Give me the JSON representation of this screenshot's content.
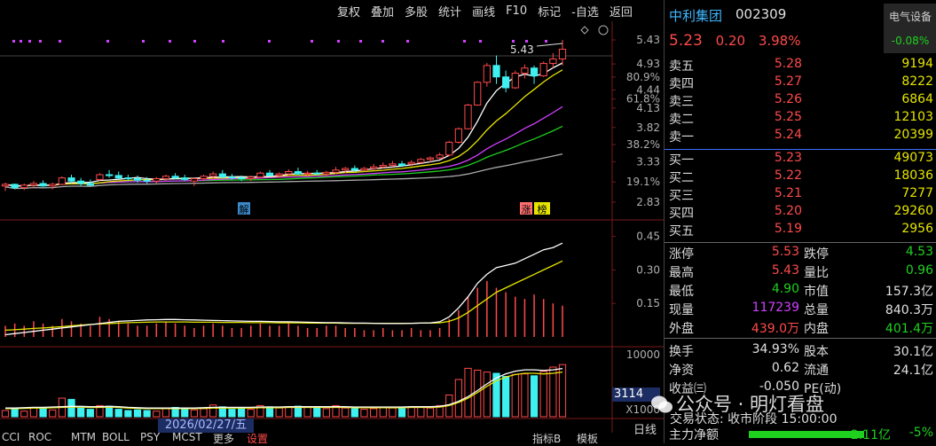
{
  "toolbar": [
    "复权",
    "叠加",
    "多股",
    "统计",
    "画线",
    "F10",
    "标记",
    "-自选",
    "返回"
  ],
  "stock": {
    "name": "中利集团",
    "code": "002309",
    "price": "5.23",
    "change": "0.20",
    "pct": "3.98%"
  },
  "sector": {
    "name": "电气设备",
    "change": "-0.08%"
  },
  "orderbook": {
    "asks": [
      {
        "l": "卖五",
        "p": "5.28",
        "v": "9194"
      },
      {
        "l": "卖四",
        "p": "5.27",
        "v": "8222"
      },
      {
        "l": "卖三",
        "p": "5.26",
        "v": "6864"
      },
      {
        "l": "卖二",
        "p": "5.25",
        "v": "12103"
      },
      {
        "l": "卖一",
        "p": "5.24",
        "v": "20399"
      }
    ],
    "bids": [
      {
        "l": "买一",
        "p": "5.23",
        "v": "49073"
      },
      {
        "l": "买二",
        "p": "5.22",
        "v": "18036"
      },
      {
        "l": "买三",
        "p": "5.21",
        "v": "7277"
      },
      {
        "l": "买四",
        "p": "5.20",
        "v": "29260"
      },
      {
        "l": "买五",
        "p": "5.19",
        "v": "2956"
      }
    ]
  },
  "stats": [
    {
      "l1": "涨停",
      "v1": "5.53",
      "c1": "r",
      "l2": "跌停",
      "v2": "4.53",
      "c2": "g"
    },
    {
      "l1": "最高",
      "v1": "5.43",
      "c1": "r",
      "l2": "量比",
      "v2": "0.96",
      "c2": "g"
    },
    {
      "l1": "最低",
      "v1": "4.90",
      "c1": "g",
      "l2": "市值",
      "v2": "157.3亿",
      "c2": "w"
    },
    {
      "l1": "现量",
      "v1": "117239",
      "c1": "m",
      "l2": "总量",
      "v2": "840.3万",
      "c2": "w"
    },
    {
      "l1": "外盘",
      "v1": "439.0万",
      "c1": "r",
      "l2": "内盘",
      "v2": "401.4万",
      "c2": "g"
    },
    {
      "l1": "换手",
      "v1": "34.93%",
      "c1": "w",
      "l2": "股本",
      "v2": "30.1亿",
      "c2": "w"
    },
    {
      "l1": "净资",
      "v1": "0.62",
      "c1": "w",
      "l2": "流通",
      "v2": "24.1亿",
      "c2": "w"
    },
    {
      "l1": "收益㈢",
      "v1": "-0.050",
      "c1": "w",
      "l2": "PE(动)",
      "v2": "",
      "c2": "w"
    }
  ],
  "trade_status": "交易状态: 收市阶段 15:00:00",
  "net_flow": {
    "label": "主力净额",
    "value": "-2.11亿",
    "pct": "-5%"
  },
  "watermark": "公众号 · 明灯看盘",
  "axis_main": [
    "5.43",
    "4.93",
    "80.9%",
    "4.44",
    "61.8%",
    "4.13",
    "3.82",
    "38.2%",
    "3.33",
    "19.1%",
    "2.83"
  ],
  "axis_ind": [
    "0.45",
    "0.30",
    "0.15"
  ],
  "axis_vol": [
    "10000",
    "X1000"
  ],
  "vol_tag": "3114",
  "date_tag": "2026/02/27/五",
  "high_label": "5.43",
  "bottom_tabs": [
    "CCI",
    "ROC",
    "MTM",
    "BOLL",
    "PSY",
    "MCST",
    "更多",
    "设置"
  ],
  "bottom_right": [
    "指标B",
    "模板"
  ],
  "xian": "日线",
  "tag_jie": "解",
  "tag_zt": "涨",
  "tag_bang": "榜",
  "colors": {
    "up": "#ff4a4a",
    "down": "#3ef0f0",
    "ma5": "#ffffff",
    "ma10": "#e5e500",
    "ma20": "#d040ff",
    "ma30": "#1fd11f",
    "ma60": "#aaaaaa"
  },
  "candles": [
    [
      3.02,
      3.06,
      2.96,
      3.04
    ],
    [
      3.04,
      3.05,
      2.98,
      3.0
    ],
    [
      3.0,
      3.05,
      2.97,
      3.03
    ],
    [
      3.03,
      3.08,
      3.0,
      3.05
    ],
    [
      3.05,
      3.09,
      3.01,
      3.02
    ],
    [
      3.02,
      3.06,
      2.98,
      3.04
    ],
    [
      3.04,
      3.14,
      3.03,
      3.12
    ],
    [
      3.12,
      3.16,
      3.05,
      3.08
    ],
    [
      3.08,
      3.12,
      3.02,
      3.05
    ],
    [
      3.05,
      3.1,
      3.02,
      3.03
    ],
    [
      3.1,
      3.18,
      3.08,
      3.16
    ],
    [
      3.16,
      3.22,
      3.12,
      3.15
    ],
    [
      3.15,
      3.2,
      3.1,
      3.12
    ],
    [
      3.12,
      3.16,
      3.08,
      3.11
    ],
    [
      3.11,
      3.15,
      3.06,
      3.09
    ],
    [
      3.09,
      3.13,
      3.05,
      3.08
    ],
    [
      3.08,
      3.13,
      3.05,
      3.11
    ],
    [
      3.11,
      3.16,
      3.08,
      3.14
    ],
    [
      3.14,
      3.18,
      3.1,
      3.12
    ],
    [
      3.12,
      3.16,
      3.08,
      3.1
    ],
    [
      3.08,
      3.12,
      3.02,
      3.11
    ],
    [
      3.11,
      3.16,
      3.08,
      3.14
    ],
    [
      3.14,
      3.2,
      3.1,
      3.17
    ],
    [
      3.17,
      3.22,
      3.12,
      3.13
    ],
    [
      3.13,
      3.17,
      3.1,
      3.12
    ],
    [
      3.12,
      3.15,
      3.08,
      3.11
    ],
    [
      3.11,
      3.15,
      3.08,
      3.13
    ],
    [
      3.13,
      3.2,
      3.12,
      3.18
    ],
    [
      3.18,
      3.22,
      3.14,
      3.15
    ],
    [
      3.15,
      3.19,
      3.12,
      3.17
    ],
    [
      3.17,
      3.23,
      3.14,
      3.2
    ],
    [
      3.2,
      3.25,
      3.15,
      3.17
    ],
    [
      3.17,
      3.21,
      3.14,
      3.18
    ],
    [
      3.18,
      3.22,
      3.15,
      3.17
    ],
    [
      3.17,
      3.21,
      3.14,
      3.19
    ],
    [
      3.19,
      3.26,
      3.17,
      3.22
    ],
    [
      3.22,
      3.26,
      3.18,
      3.24
    ],
    [
      3.24,
      3.28,
      3.2,
      3.22
    ],
    [
      3.22,
      3.26,
      3.2,
      3.24
    ],
    [
      3.24,
      3.3,
      3.22,
      3.26
    ],
    [
      3.26,
      3.32,
      3.24,
      3.28
    ],
    [
      3.28,
      3.34,
      3.26,
      3.3
    ],
    [
      3.3,
      3.34,
      3.26,
      3.28
    ],
    [
      3.3,
      3.35,
      3.27,
      3.32
    ],
    [
      3.32,
      3.38,
      3.3,
      3.36
    ],
    [
      3.36,
      3.4,
      3.32,
      3.38
    ],
    [
      3.38,
      3.45,
      3.36,
      3.42
    ],
    [
      3.42,
      3.62,
      3.4,
      3.6
    ],
    [
      3.6,
      3.82,
      3.58,
      3.8
    ],
    [
      3.8,
      4.2,
      3.79,
      4.18
    ],
    [
      4.18,
      4.6,
      4.17,
      4.58
    ],
    [
      4.58,
      4.95,
      4.5,
      4.9
    ],
    [
      4.9,
      5.1,
      4.55,
      4.68
    ],
    [
      4.68,
      4.8,
      4.4,
      4.48
    ],
    [
      4.48,
      4.8,
      4.46,
      4.75
    ],
    [
      4.75,
      4.92,
      4.65,
      4.85
    ],
    [
      4.85,
      4.9,
      4.55,
      4.7
    ],
    [
      4.7,
      4.98,
      4.68,
      4.94
    ],
    [
      4.94,
      5.15,
      4.85,
      5.03
    ],
    [
      5.03,
      5.43,
      4.9,
      5.23
    ]
  ],
  "ind_bars": [
    0.05,
    0.06,
    0.05,
    0.07,
    0.06,
    0.05,
    0.08,
    0.07,
    0.06,
    0.05,
    0.09,
    0.08,
    0.07,
    0.06,
    0.05,
    0.05,
    0.06,
    0.07,
    0.06,
    0.05,
    0.04,
    0.05,
    0.06,
    0.05,
    0.04,
    0.04,
    0.05,
    0.06,
    0.05,
    0.05,
    0.06,
    0.05,
    0.04,
    0.04,
    0.05,
    0.05,
    0.04,
    0.04,
    0.03,
    0.03,
    0.04,
    0.03,
    0.03,
    0.04,
    0.03,
    0.03,
    0.04,
    0.08,
    0.12,
    0.18,
    0.22,
    0.25,
    0.22,
    0.2,
    0.18,
    0.17,
    0.19,
    0.17,
    0.15,
    0.14
  ],
  "ind_white": [
    0.01,
    0.015,
    0.02,
    0.025,
    0.03,
    0.035,
    0.04,
    0.045,
    0.05,
    0.055,
    0.06,
    0.065,
    0.07,
    0.072,
    0.074,
    0.076,
    0.077,
    0.078,
    0.078,
    0.077,
    0.076,
    0.075,
    0.074,
    0.073,
    0.072,
    0.071,
    0.07,
    0.07,
    0.069,
    0.068,
    0.068,
    0.067,
    0.066,
    0.065,
    0.064,
    0.064,
    0.063,
    0.062,
    0.062,
    0.061,
    0.06,
    0.06,
    0.06,
    0.061,
    0.062,
    0.063,
    0.068,
    0.09,
    0.13,
    0.18,
    0.24,
    0.28,
    0.31,
    0.32,
    0.33,
    0.35,
    0.37,
    0.39,
    0.4,
    0.42
  ],
  "ind_yellow": [
    0.03,
    0.032,
    0.035,
    0.038,
    0.04,
    0.043,
    0.046,
    0.05,
    0.053,
    0.056,
    0.058,
    0.06,
    0.062,
    0.064,
    0.065,
    0.066,
    0.067,
    0.067,
    0.067,
    0.067,
    0.066,
    0.066,
    0.066,
    0.065,
    0.065,
    0.065,
    0.064,
    0.064,
    0.064,
    0.063,
    0.063,
    0.063,
    0.062,
    0.062,
    0.062,
    0.062,
    0.061,
    0.061,
    0.061,
    0.061,
    0.061,
    0.061,
    0.061,
    0.061,
    0.062,
    0.062,
    0.063,
    0.07,
    0.085,
    0.11,
    0.14,
    0.17,
    0.2,
    0.22,
    0.24,
    0.26,
    0.28,
    0.3,
    0.32,
    0.34
  ],
  "volumes": [
    1000,
    1200,
    900,
    1500,
    1300,
    1100,
    3000,
    2800,
    1400,
    1200,
    1800,
    1700,
    1200,
    1000,
    1100,
    1000,
    900,
    1300,
    1500,
    1200,
    1100,
    1300,
    1900,
    1600,
    1200,
    1300,
    1200,
    1800,
    1600,
    1400,
    1500,
    1700,
    1500,
    1400,
    1300,
    1800,
    1400,
    1300,
    1200,
    1300,
    1500,
    1400,
    1300,
    1600,
    1500,
    1400,
    1800,
    3500,
    6000,
    7800,
    7500,
    7200,
    7000,
    6500,
    6800,
    6900,
    6600,
    7300,
    8000,
    8400
  ],
  "vol_ma": [
    1300,
    1300,
    1350,
    1400,
    1400,
    1450,
    1500,
    1550,
    1550,
    1500,
    1500,
    1550,
    1500,
    1400,
    1350,
    1300,
    1300,
    1300,
    1300,
    1300,
    1300,
    1350,
    1400,
    1400,
    1400,
    1400,
    1400,
    1450,
    1450,
    1450,
    1500,
    1500,
    1500,
    1500,
    1500,
    1500,
    1500,
    1450,
    1450,
    1450,
    1450,
    1450,
    1450,
    1500,
    1500,
    1500,
    1550,
    1800,
    2300,
    3000,
    3900,
    4900,
    5800,
    6400,
    6800,
    7000,
    7000,
    6900,
    7000,
    7200
  ]
}
